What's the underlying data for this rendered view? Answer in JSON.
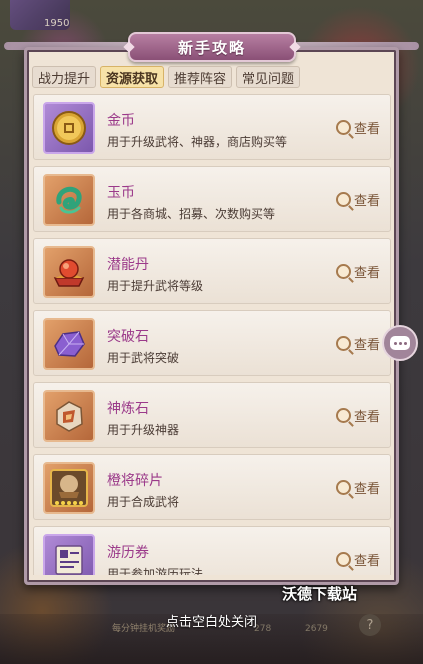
{
  "background": {
    "top_left_number": "1950",
    "bottom_strip_text": "每分钟挂机奖励",
    "bottom_number_1": "278",
    "bottom_number_2": "2679",
    "help_symbol": "?"
  },
  "panel": {
    "title": "新手攻略",
    "tabs": [
      {
        "label": "战力提升",
        "active": false
      },
      {
        "label": "资源获取",
        "active": true
      },
      {
        "label": "推荐阵容",
        "active": false
      },
      {
        "label": "常见问题",
        "active": false
      }
    ],
    "items": [
      {
        "name": "金币",
        "desc": "用于升级武将、神器，商店购买等",
        "icon": "gold-coin-icon",
        "frame": "purple",
        "action": "查看"
      },
      {
        "name": "玉币",
        "desc": "用于各商城、招募、次数购买等",
        "icon": "jade-coin-icon",
        "frame": "orange",
        "action": "查看"
      },
      {
        "name": "潜能丹",
        "desc": "用于提升武将等级",
        "icon": "potential-pill-icon",
        "frame": "orange",
        "action": "查看"
      },
      {
        "name": "突破石",
        "desc": "用于武将突破",
        "icon": "breakthrough-stone-icon",
        "frame": "orange",
        "action": "查看"
      },
      {
        "name": "神炼石",
        "desc": "用于升级神器",
        "icon": "divine-stone-icon",
        "frame": "orange",
        "action": "查看"
      },
      {
        "name": "橙将碎片",
        "desc": "用于合成武将",
        "icon": "hero-shard-icon",
        "frame": "orange",
        "action": "查看"
      },
      {
        "name": "游历券",
        "desc": "用于参加游历玩法",
        "icon": "travel-ticket-icon",
        "frame": "purple",
        "action": "查看"
      }
    ]
  },
  "close_hint": "点击空白处关闭",
  "watermark": "沃德下载站",
  "colors": {
    "item_name": "#9b3a8a",
    "tab_active": "#f7e2a8",
    "title_plate": "#8a5076"
  }
}
